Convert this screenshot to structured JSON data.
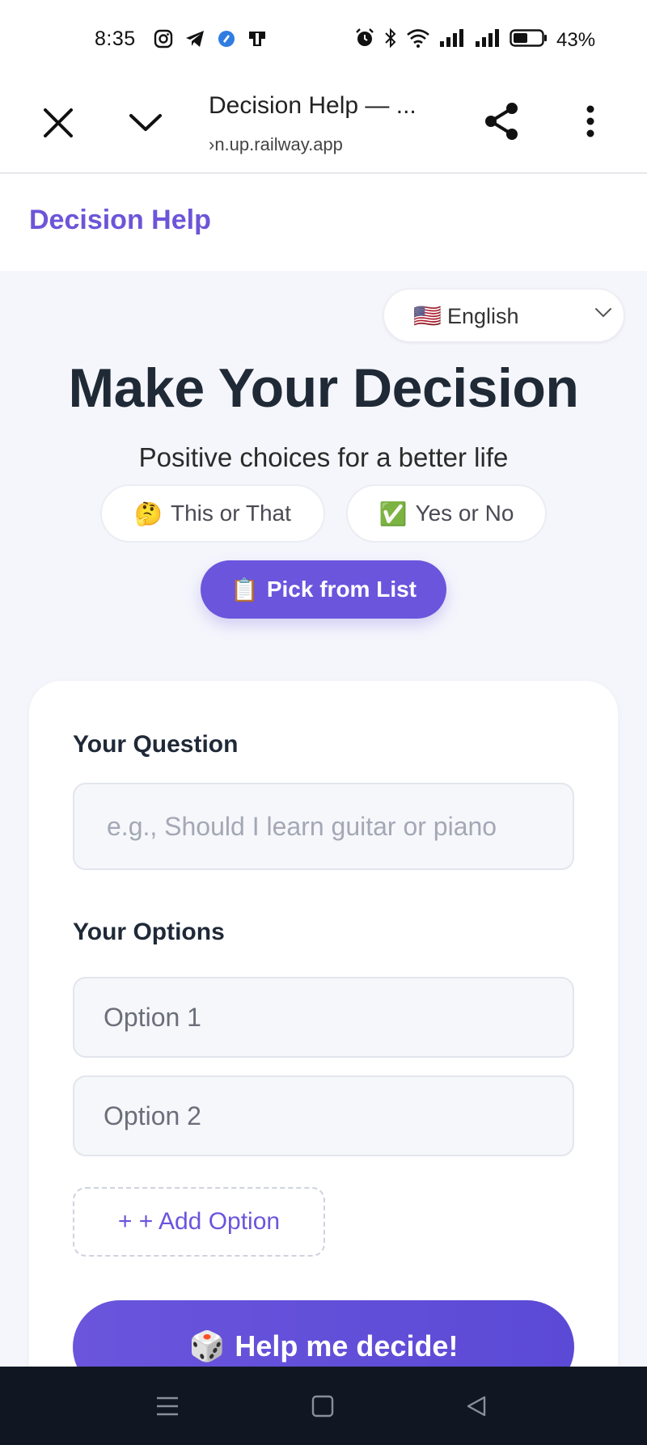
{
  "status_bar": {
    "time": "8:35",
    "battery": "43%",
    "icons": [
      "instagram-icon",
      "telegram-icon",
      "app-icon",
      "notification-icon",
      "alarm-icon",
      "bluetooth-icon",
      "wifi-icon",
      "signal-icon",
      "signal-icon",
      "battery-icon"
    ]
  },
  "browser": {
    "title": "Decision Help — ...",
    "url": "›n.up.railway.app",
    "icons": [
      "close-icon",
      "chevron-down-icon",
      "share-icon",
      "more-vertical-icon"
    ]
  },
  "header": {
    "brand": "Decision Help",
    "brand_color": "#6d55d8"
  },
  "language": {
    "flag": "🇺🇸",
    "selected": "English"
  },
  "hero": {
    "title": "Make Your Decision",
    "subtitle": "Positive choices for a better life"
  },
  "modes": {
    "this_or_that": {
      "emoji": "🤔",
      "label": "This or That"
    },
    "yes_or_no": {
      "emoji": "✅",
      "label": "Yes or No"
    },
    "pick_from_list": {
      "emoji": "📋",
      "label": "Pick from List",
      "active": true
    }
  },
  "form": {
    "question_label": "Your Question",
    "question_placeholder": "e.g., Should I learn guitar or piano",
    "question_value": "",
    "options_label": "Your Options",
    "option1_placeholder": "Option 1",
    "option2_placeholder": "Option 2",
    "add_option_label": "+ + Add Option",
    "decide_emoji": "🎲",
    "decide_label": "Help me decide!"
  },
  "colors": {
    "accent": "#6a55dc",
    "background": "#f5f6fc",
    "nav_bar": "#111722"
  }
}
